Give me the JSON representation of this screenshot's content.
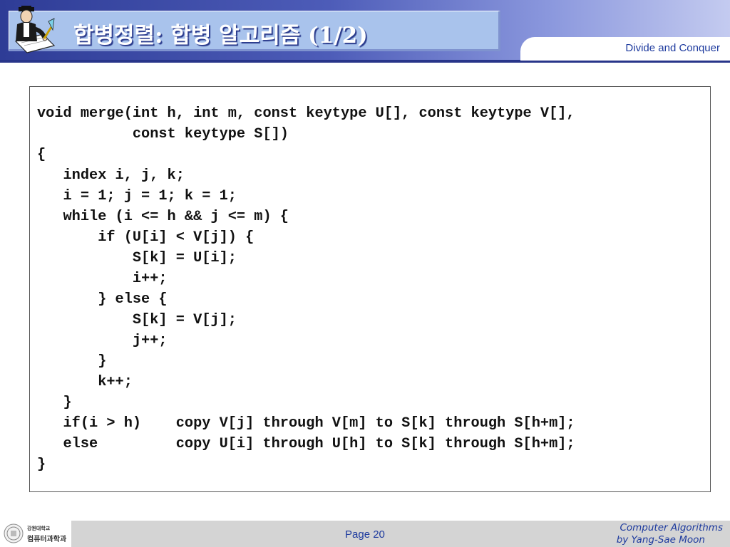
{
  "header": {
    "title": "합병정렬: 합병 알고리즘 (1/2)",
    "subtitle": "Divide and Conquer"
  },
  "code": {
    "lines": [
      "void merge(int h, int m, const keytype U[], const keytype V[],",
      "           const keytype S[])",
      "{",
      "   index i, j, k;",
      "   i = 1; j = 1; k = 1;",
      "   while (i <= h && j <= m) {",
      "       if (U[i] < V[j]) {",
      "           S[k] = U[i];",
      "           i++;",
      "       } else {",
      "           S[k] = V[j];",
      "           j++;",
      "       }",
      "       k++;",
      "   }",
      "   if(i > h)    copy V[j] through V[m] to S[k] through S[h+m];",
      "   else         copy U[i] through U[h] to S[k] through S[h+m];",
      "}"
    ]
  },
  "footer": {
    "logo_university": "강원대학교",
    "logo_department": "컴퓨터과학과",
    "page": "Page 20",
    "credit_line1": "Computer Algorithms",
    "credit_line2": "by Yang-Sae Moon"
  }
}
